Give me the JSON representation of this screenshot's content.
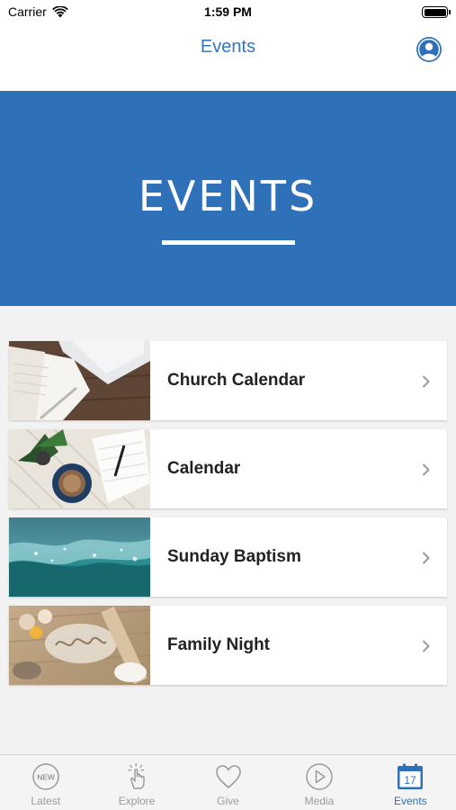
{
  "status_bar": {
    "carrier": "Carrier",
    "time": "1:59 PM"
  },
  "nav": {
    "title": "Events",
    "profile_icon": "user-circle-icon"
  },
  "banner": {
    "title": "EVENTS"
  },
  "events": [
    {
      "label": "Church Calendar",
      "thumb": "notebook-on-desk-photo"
    },
    {
      "label": "Calendar",
      "thumb": "coffee-and-notebook-photo"
    },
    {
      "label": "Sunday Baptism",
      "thumb": "water-splash-photo"
    },
    {
      "label": "Family Night",
      "thumb": "family-flour-baking-photo"
    }
  ],
  "tabs": [
    {
      "label": "Latest",
      "icon": "new-badge-icon",
      "active": false
    },
    {
      "label": "Explore",
      "icon": "tap-hand-icon",
      "active": false
    },
    {
      "label": "Give",
      "icon": "heart-icon",
      "active": false
    },
    {
      "label": "Media",
      "icon": "play-circle-icon",
      "active": false
    },
    {
      "label": "Events",
      "icon": "calendar-icon",
      "calendar_day": "17",
      "active": true
    }
  ],
  "colors": {
    "accent": "#2e71b9",
    "nav_title": "#3177c1",
    "tab_inactive": "#9a9a9a",
    "background": "#f2f2f2"
  }
}
